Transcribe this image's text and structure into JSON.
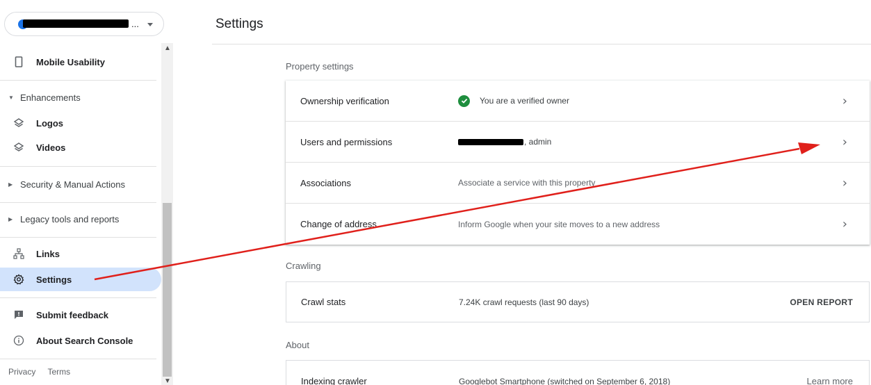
{
  "property_selector": {
    "ellipsis": "..."
  },
  "sidebar": {
    "items": {
      "mobile_usability": "Mobile Usability",
      "enhancements": "Enhancements",
      "logos": "Logos",
      "videos": "Videos",
      "security": "Security & Manual Actions",
      "legacy": "Legacy tools and reports",
      "links": "Links",
      "settings": "Settings",
      "submit_feedback": "Submit feedback",
      "about": "About Search Console"
    },
    "footer": {
      "privacy": "Privacy",
      "terms": "Terms"
    }
  },
  "header": {
    "title": "Settings"
  },
  "property_settings": {
    "label": "Property settings",
    "rows": [
      {
        "label": "Ownership verification",
        "value": "You are a verified owner"
      },
      {
        "label": "Users and permissions",
        "value": ", admin"
      },
      {
        "label": "Associations",
        "value": "Associate a service with this property"
      },
      {
        "label": "Change of address",
        "value": "Inform Google when your site moves to a new address"
      }
    ]
  },
  "crawling": {
    "label": "Crawling",
    "row": {
      "label": "Crawl stats",
      "value": "7.24K crawl requests (last 90 days)",
      "action": "OPEN REPORT"
    }
  },
  "about": {
    "label": "About",
    "row": {
      "label": "Indexing crawler",
      "value": "Googlebot Smartphone (switched on September 6, 2018)",
      "link": "Learn more"
    }
  },
  "colors": {
    "accent_active": "#d2e3fc",
    "verified": "#1e8e3e",
    "annotation_arrow": "#e0201b"
  },
  "icons": [
    "phone-icon",
    "layers-icon",
    "sitemap-icon",
    "gear-icon",
    "feedback-icon",
    "info-icon",
    "chevron-right-icon",
    "check-circle-icon"
  ]
}
